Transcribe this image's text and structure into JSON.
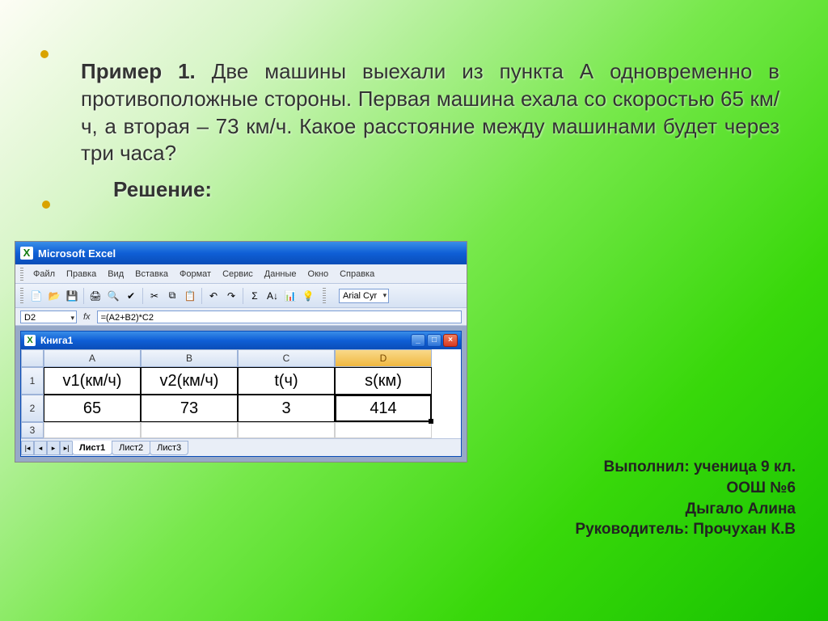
{
  "problem": {
    "title_bold": "Пример 1.",
    "text": " Две машины выехали из пункта А одновременно в противоположные стороны. Первая машина ехала со скоростью 65 км/ч, а вторая – 73 км/ч. Какое расстояние между машинами будет через три часа?",
    "solution_label": "Решение:"
  },
  "excel": {
    "app_title": "Microsoft Excel",
    "menus": [
      "Файл",
      "Правка",
      "Вид",
      "Вставка",
      "Формат",
      "Сервис",
      "Данные",
      "Окно",
      "Справка"
    ],
    "toolbar_icons": [
      "new-doc",
      "open",
      "save",
      "print",
      "preview",
      "spell",
      "cut",
      "copy",
      "paste",
      "undo",
      "redo",
      "sum",
      "chart",
      "help"
    ],
    "font_name": "Arial Cyr",
    "name_box": "D2",
    "fx_label": "fx",
    "formula": "=(A2+B2)*C2",
    "workbook_title": "Книга1",
    "columns": [
      "A",
      "B",
      "C",
      "D"
    ],
    "row1": [
      "v1(км/ч)",
      "v2(км/ч)",
      "t(ч)",
      "s(км)"
    ],
    "row2": [
      "65",
      "73",
      "3",
      "414"
    ],
    "selected_cell": "D2",
    "sheets": [
      "Лист1",
      "Лист2",
      "Лист3"
    ],
    "active_sheet": 0,
    "win_min": "_",
    "win_max": "□",
    "win_close": "×"
  },
  "credits": {
    "line1": "Выполнил: ученица 9 кл.",
    "line2": "ООШ №6",
    "line3": "Дыгало Алина",
    "line4": "Руководитель: Прочухан К.В"
  }
}
